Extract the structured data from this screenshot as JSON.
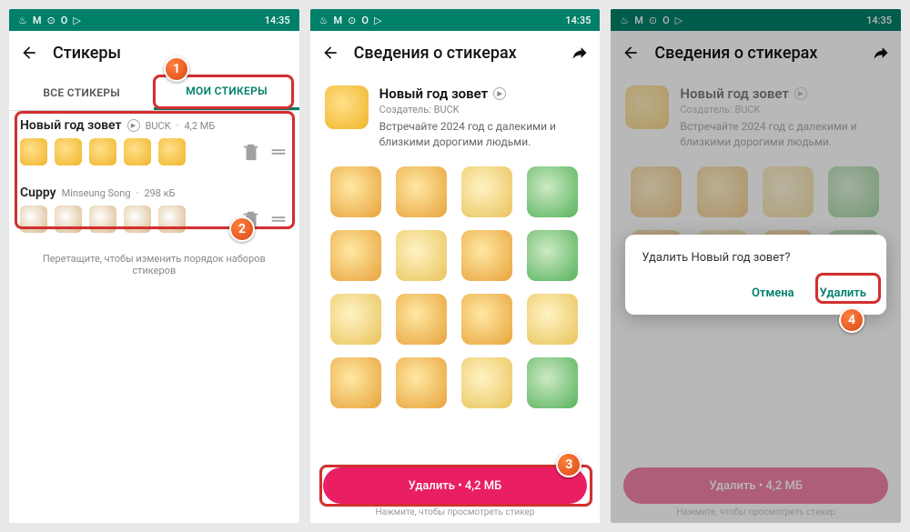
{
  "status": {
    "time": "14:35"
  },
  "screen1": {
    "title": "Стикеры",
    "tabs": {
      "all": "ВСЕ СТИКЕРЫ",
      "my": "МОИ СТИКЕРЫ"
    },
    "packs": [
      {
        "name": "Новый год зовет",
        "author": "BUCK",
        "size": "4,2 МБ"
      },
      {
        "name": "Cuppy",
        "author": "Minseung Song",
        "size": "298 кБ"
      }
    ],
    "drag_hint": "Перетащите, чтобы изменить порядок наборов стикеров"
  },
  "screen2": {
    "title": "Сведения о стикерах",
    "pack_title": "Новый год зовет",
    "creator_label": "Создатель: BUCK",
    "description": "Встречайте 2024 год с далекими и близкими дорогими людьми.",
    "delete_label": "Удалить • 4,2 МБ",
    "tap_hint": "Нажмите, чтобы просмотреть стикер"
  },
  "screen3": {
    "title": "Сведения о стикерах",
    "pack_title": "Новый год зовет",
    "creator_label": "Создатель: BUCK",
    "description": "Встречайте 2024 год с далекими и близкими дорогими людьми.",
    "delete_label": "Удалить • 4,2 МБ",
    "tap_hint": "Нажмите, чтобы просмотреть стикер",
    "dialog": {
      "message": "Удалить Новый год зовет?",
      "cancel": "Отмена",
      "confirm": "Удалить"
    }
  },
  "markers": {
    "m1": "1",
    "m2": "2",
    "m3": "3",
    "m4": "4"
  }
}
